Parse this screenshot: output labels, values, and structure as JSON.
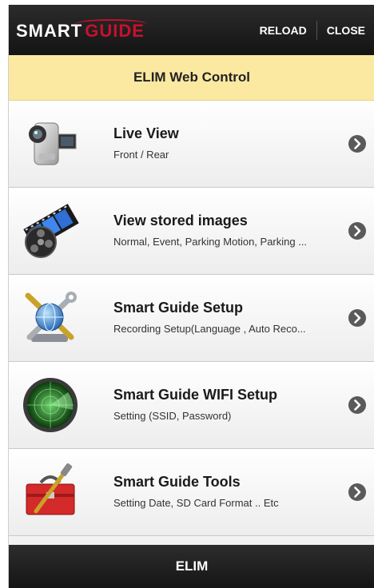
{
  "header": {
    "logo_text_1": "SMART",
    "logo_text_2": "GUIDE",
    "reload_label": "RELOAD",
    "close_label": "CLOSE"
  },
  "titlebar": {
    "title": "ELIM Web Control"
  },
  "menu": [
    {
      "title": "Live View",
      "subtitle": "Front / Rear",
      "icon": "camcorder-icon"
    },
    {
      "title": "View stored images",
      "subtitle": "Normal, Event, Parking Motion, Parking ...",
      "icon": "film-reel-icon"
    },
    {
      "title": "Smart Guide Setup",
      "subtitle": "Recording Setup(Language , Auto Reco...",
      "icon": "tools-globe-icon"
    },
    {
      "title": "Smart Guide WIFI Setup",
      "subtitle": "Setting (SSID, Password)",
      "icon": "radar-icon"
    },
    {
      "title": "Smart Guide Tools",
      "subtitle": "Setting Date, SD Card Format .. Etc",
      "icon": "toolbox-icon"
    }
  ],
  "footer": {
    "label": "ELIM"
  },
  "colors": {
    "accent": "#c8102e",
    "titlebar_bg": "#fbe9a2",
    "header_bg": "#1e1e1e"
  }
}
